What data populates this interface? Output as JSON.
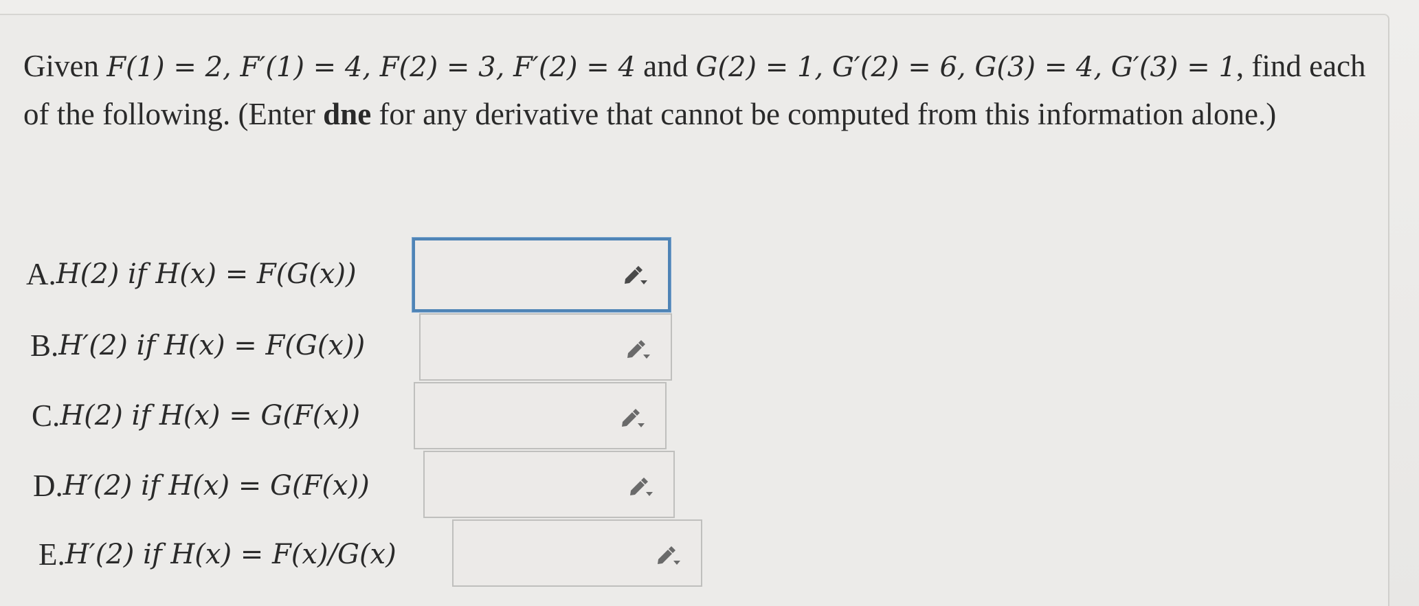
{
  "prompt": {
    "p1": "Given ",
    "m1": "F(1) = 2, F′(1) = 4, F(2) = 3, F′(2) = 4",
    "p2": " and ",
    "m2": "G(2) = 1, G′(2) = 6, G(3) = 4, G′(3) = 1",
    "p3": ", find each of the following. (Enter ",
    "dne": "dne",
    "p4": " for any derivative that cannot be computed from this information alone.)"
  },
  "parts": [
    {
      "label": "A. ",
      "math": "H(2) if H(x) = F(G(x))",
      "value": ""
    },
    {
      "label": "B. ",
      "math": "H′(2) if H(x) = F(G(x))",
      "value": ""
    },
    {
      "label": "C. ",
      "math": "H(2) if H(x) = G(F(x))",
      "value": ""
    },
    {
      "label": "D. ",
      "math": "H′(2) if H(x) = G(F(x))",
      "value": ""
    },
    {
      "label": "E. ",
      "math": "H′(2) if H(x) = F(x)/G(x)",
      "value": ""
    }
  ],
  "icons": {
    "answer_tool": "pencil-dropdown-icon"
  },
  "colors": {
    "focus_border": "#4f84b6",
    "box_border": "#bfbfbd"
  }
}
